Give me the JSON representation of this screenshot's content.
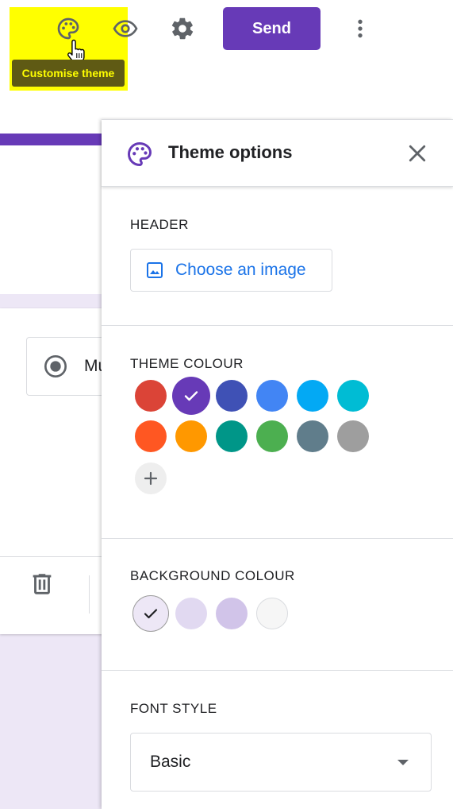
{
  "toolbar": {
    "send_label": "Send",
    "tooltip": "Customise theme",
    "icons": [
      "palette-icon",
      "eye-icon",
      "gear-icon",
      "more-vert-icon",
      "hand-cursor-icon"
    ]
  },
  "form": {
    "question_type_label": "Mu",
    "accent_color": "#673ab7",
    "background_color": "#ede7f6"
  },
  "theme_panel": {
    "title": "Theme options",
    "header": {
      "label": "HEADER",
      "choose_image_label": "Choose an image"
    },
    "theme_colour": {
      "label": "THEME COLOUR",
      "colors": [
        "#db4437",
        "#673ab7",
        "#3f51b5",
        "#4285f4",
        "#03a9f4",
        "#00bcd4",
        "#ff5722",
        "#ff9800",
        "#009688",
        "#4caf50",
        "#607d8b",
        "#9e9e9e"
      ],
      "selected": "#673ab7",
      "add_label": "+"
    },
    "background_colour": {
      "label": "BACKGROUND COLOUR",
      "colors": [
        "#ede7f6",
        "#e1d9f1",
        "#d1c4e9",
        "#f6f6f6"
      ],
      "selected": "#ede7f6"
    },
    "font_style": {
      "label": "FONT STYLE",
      "value": "Basic"
    }
  }
}
